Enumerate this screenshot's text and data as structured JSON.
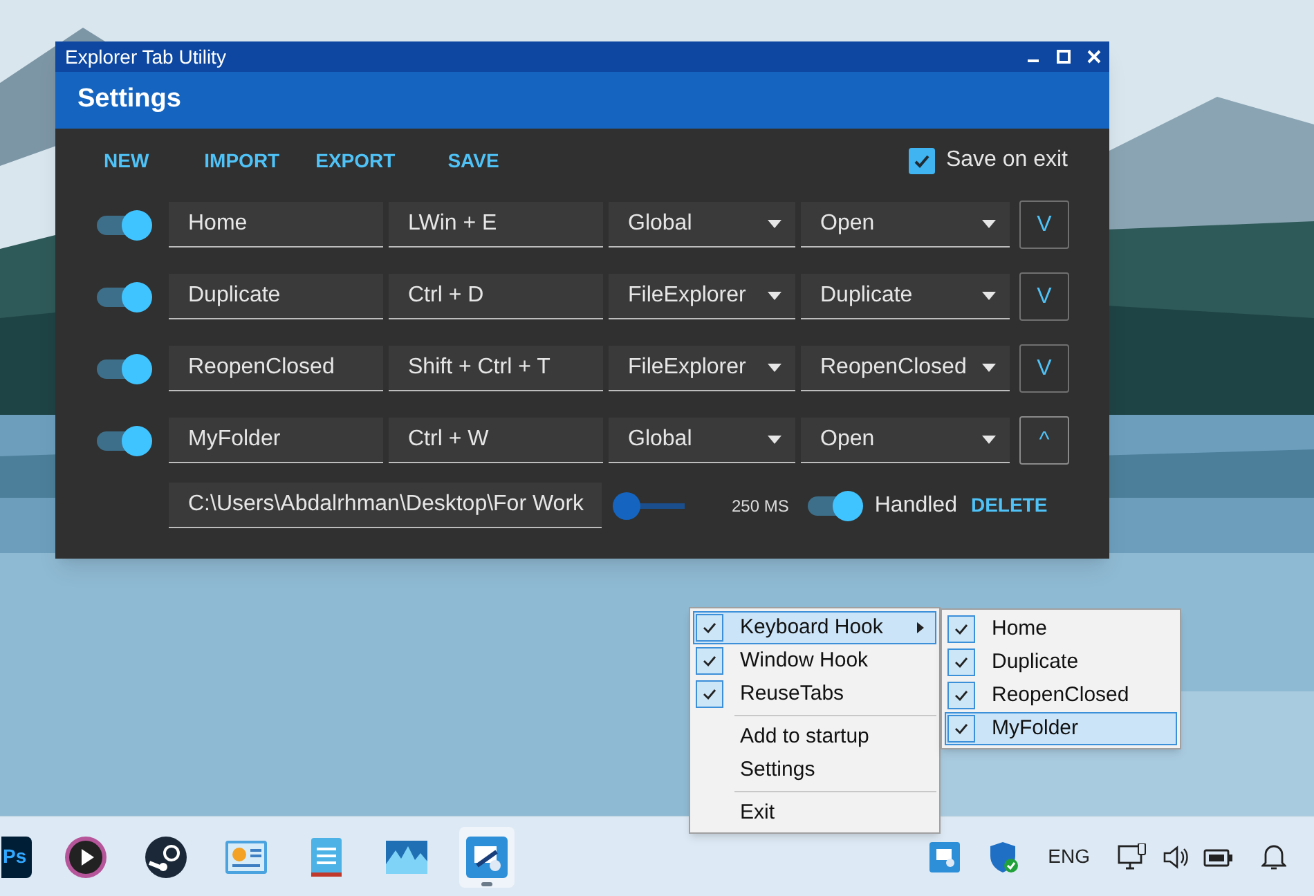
{
  "window": {
    "title": "Explorer Tab Utility",
    "header": "Settings"
  },
  "toolbar": [
    "NEW",
    "IMPORT",
    "EXPORT",
    "SAVE"
  ],
  "save_on_exit": {
    "label": "Save on exit",
    "checked": true
  },
  "hotkeys": [
    {
      "enabled": true,
      "name": "Home",
      "keys": "LWin + E",
      "scope": "Global",
      "action": "Open",
      "expanded": false,
      "expand_glyph": "V"
    },
    {
      "enabled": true,
      "name": "Duplicate",
      "keys": "Ctrl + D",
      "scope": "FileExplorer",
      "action": "Duplicate",
      "expanded": false,
      "expand_glyph": "V"
    },
    {
      "enabled": true,
      "name": "ReopenClosed",
      "keys": "Shift + Ctrl + T",
      "scope": "FileExplorer",
      "action": "ReopenClosed",
      "expanded": false,
      "expand_glyph": "V"
    },
    {
      "enabled": true,
      "name": "MyFolder",
      "keys": "Ctrl + W",
      "scope": "Global",
      "action": "Open",
      "expanded": true,
      "expand_glyph": "^"
    }
  ],
  "detail": {
    "path": "C:\\Users\\Abdalrhman\\Desktop\\For Work",
    "level": 0,
    "delay": "250 MS",
    "handled_label": "Handled",
    "handled_on": true,
    "delete": "DELETE"
  },
  "tray_menu": {
    "items": [
      {
        "kind": "check",
        "label": "Keyboard Hook",
        "checked": true,
        "selected": true,
        "submenu": true
      },
      {
        "kind": "check",
        "label": "Window Hook",
        "checked": true,
        "selected": false,
        "submenu": false
      },
      {
        "kind": "check",
        "label": "ReuseTabs",
        "checked": true,
        "selected": false,
        "submenu": false
      },
      {
        "kind": "separator"
      },
      {
        "kind": "command",
        "label": "Add to startup",
        "selected": false
      },
      {
        "kind": "command",
        "label": "Settings",
        "selected": false
      },
      {
        "kind": "separator"
      },
      {
        "kind": "command",
        "label": "Exit",
        "selected": false
      }
    ],
    "submenu": [
      {
        "label": "Home",
        "checked": true,
        "selected": false
      },
      {
        "label": "Duplicate",
        "checked": true,
        "selected": false
      },
      {
        "label": "ReopenClosed",
        "checked": true,
        "selected": false
      },
      {
        "label": "MyFolder",
        "checked": true,
        "selected": true
      }
    ]
  },
  "taskbar": {
    "apps": [
      {
        "kind": "ps",
        "label": "Ps",
        "active": false
      },
      {
        "kind": "player",
        "active": false
      },
      {
        "kind": "steam",
        "active": false
      },
      {
        "kind": "dashboard",
        "active": false
      },
      {
        "kind": "notepad",
        "active": false
      },
      {
        "kind": "monitor",
        "active": false
      },
      {
        "kind": "utility",
        "active": true
      }
    ],
    "language": "ENG"
  }
}
